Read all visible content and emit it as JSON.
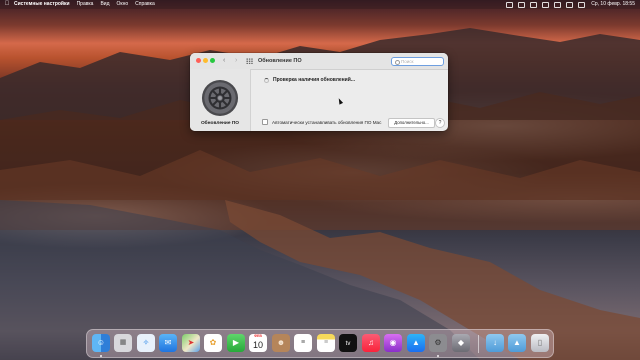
{
  "menubar": {
    "apple_icon": "apple-logo-icon",
    "app_name": "Системные настройки",
    "items": [
      "Правка",
      "Вид",
      "Окно",
      "Справка"
    ],
    "status_icons": [
      "battery-icon",
      "audio-icon",
      "keyboard-icon",
      "wifi-icon",
      "search-icon",
      "control-center-icon",
      "siri-icon"
    ],
    "clock": "Ср, 10 февр. 18:55"
  },
  "window": {
    "title": "Обновление ПО",
    "search_placeholder": "Поиск",
    "panel_label": "Обновление ПО",
    "status_text": "Проверка наличия обновлений...",
    "auto_update_label": "Автоматически устанавливать обновления ПО Mac",
    "more_button": "Дополнительно...",
    "help_button": "?"
  },
  "dock": {
    "calendar_month": "ФЕВ",
    "calendar_day": "10",
    "tv_label": "tv",
    "apps": [
      "finder-icon",
      "launchpad-icon",
      "safari-icon",
      "mail-icon",
      "maps-icon",
      "photos-icon",
      "facetime-icon",
      "calendar-icon",
      "contacts-icon",
      "reminders-icon",
      "notes-icon",
      "apple-tv-icon",
      "music-icon",
      "podcasts-icon",
      "app-store-icon",
      "system-preferences-icon",
      "utility-icon",
      "downloads-folder-icon",
      "applications-folder-icon",
      "trash-icon"
    ]
  },
  "colors": {
    "accent": "#6e9fe0",
    "close": "#ff5f57",
    "minimize": "#febc2e",
    "zoom": "#28c840"
  }
}
